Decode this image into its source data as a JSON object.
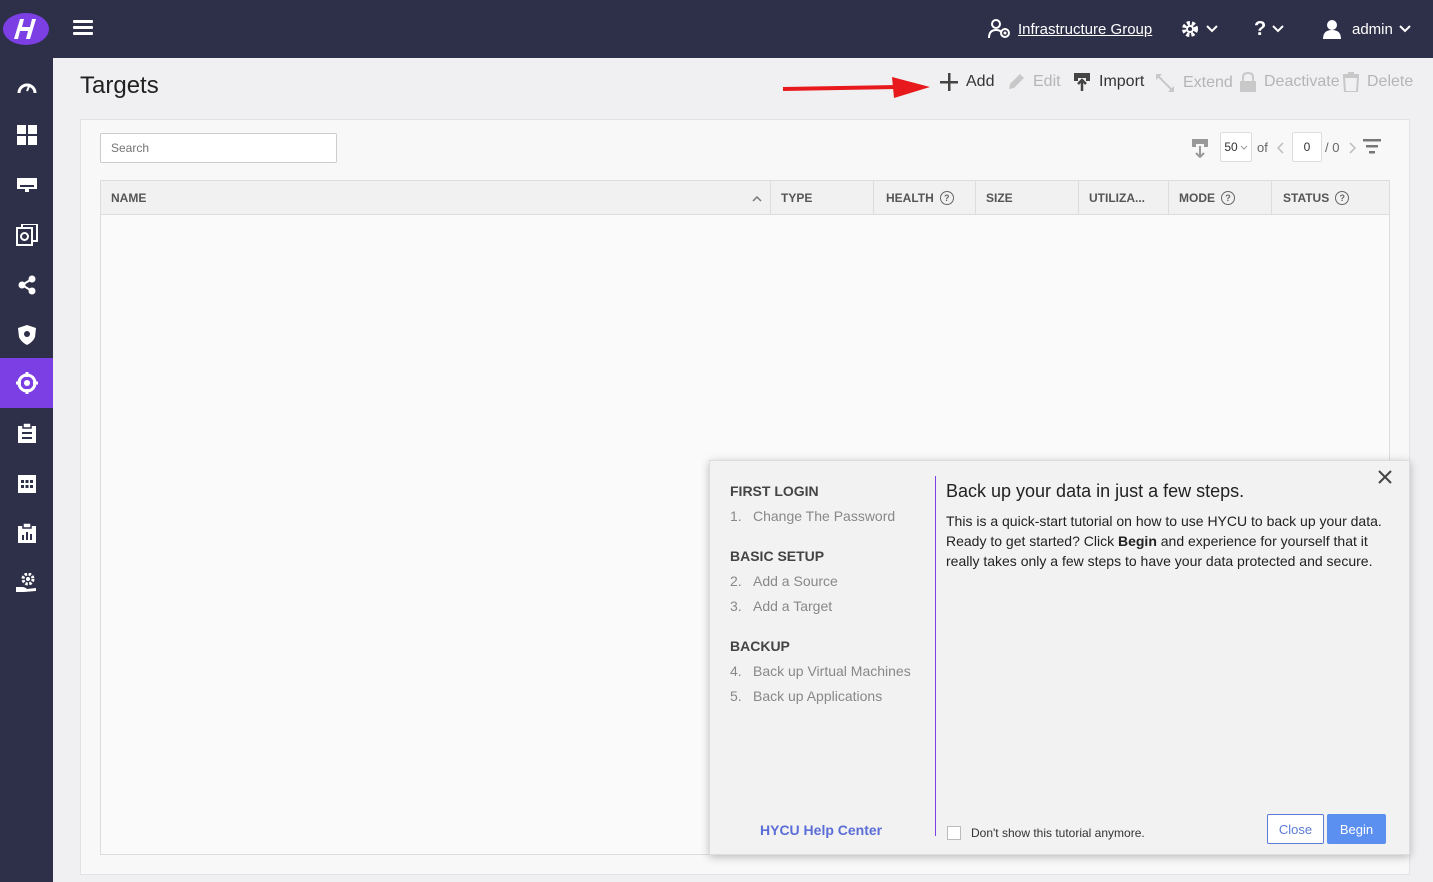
{
  "header": {
    "group_label": "Infrastructure Group",
    "user_label": "admin",
    "help_label": "?"
  },
  "page": {
    "title": "Targets"
  },
  "toolbar": {
    "add": "Add",
    "edit": "Edit",
    "import": "Import",
    "extend": "Extend",
    "deactivate": "Deactivate",
    "delete": "Delete"
  },
  "search": {
    "placeholder": "Search"
  },
  "pager": {
    "page_size": "50",
    "of_label": "of",
    "current_page": "0",
    "total_pages": "/ 0"
  },
  "table": {
    "columns": [
      "NAME",
      "TYPE",
      "HEALTH",
      "SIZE",
      "UTILIZA...",
      "MODE",
      "STATUS"
    ]
  },
  "tutorial": {
    "sections": [
      {
        "title": "FIRST LOGIN",
        "steps": [
          {
            "num": "1.",
            "label": "Change The Password"
          }
        ]
      },
      {
        "title": "BASIC SETUP",
        "steps": [
          {
            "num": "2.",
            "label": "Add a Source"
          },
          {
            "num": "3.",
            "label": "Add a Target"
          }
        ]
      },
      {
        "title": "BACKUP",
        "steps": [
          {
            "num": "4.",
            "label": "Back up Virtual Machines"
          },
          {
            "num": "5.",
            "label": "Back up Applications"
          }
        ]
      }
    ],
    "title": "Back up your data in just a few steps.",
    "body_part1": "This is a quick-start tutorial on how to use HYCU to back up your data. Ready to get started? Click ",
    "body_bold": "Begin",
    "body_part2": " and experience for yourself that it really takes only a few steps to have your data protected and secure.",
    "help_center": "HYCU Help Center",
    "dont_show": "Don't show this tutorial anymore.",
    "close_button": "Close",
    "begin_button": "Begin"
  },
  "colors": {
    "nav_bg": "#2e2f48",
    "accent": "#7b3fe4",
    "link": "#5b6dd6",
    "primary_button": "#5b8ff0",
    "arrow": "#e8191c"
  }
}
